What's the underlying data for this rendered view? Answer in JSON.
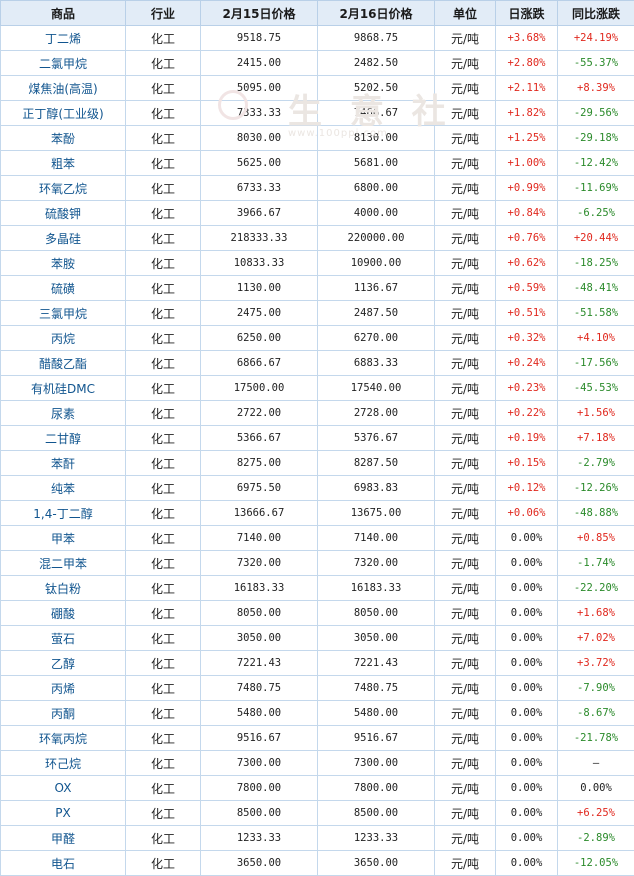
{
  "headers": [
    "商品",
    "行业",
    "2月15日价格",
    "2月16日价格",
    "单位",
    "日涨跌",
    "同比涨跌"
  ],
  "watermark": {
    "text": "生 意 社",
    "url": "www.100ppi.com"
  },
  "colors": {
    "up": "#e0281e",
    "down": "#2a8a2a",
    "header_bg": "#e2ecf7",
    "link": "#11558f"
  },
  "rows": [
    {
      "name": "丁二烯",
      "ind": "化工",
      "p1": "9518.75",
      "p2": "9868.75",
      "unit": "元/吨",
      "day": "+3.68%",
      "yoy": "+24.19%"
    },
    {
      "name": "二氯甲烷",
      "ind": "化工",
      "p1": "2415.00",
      "p2": "2482.50",
      "unit": "元/吨",
      "day": "+2.80%",
      "yoy": "-55.37%"
    },
    {
      "name": "煤焦油(高温)",
      "ind": "化工",
      "p1": "5095.00",
      "p2": "5202.50",
      "unit": "元/吨",
      "day": "+2.11%",
      "yoy": "+8.39%"
    },
    {
      "name": "正丁醇(工业级)",
      "ind": "化工",
      "p1": "7333.33",
      "p2": "7466.67",
      "unit": "元/吨",
      "day": "+1.82%",
      "yoy": "-29.56%"
    },
    {
      "name": "苯酚",
      "ind": "化工",
      "p1": "8030.00",
      "p2": "8130.00",
      "unit": "元/吨",
      "day": "+1.25%",
      "yoy": "-29.18%"
    },
    {
      "name": "粗苯",
      "ind": "化工",
      "p1": "5625.00",
      "p2": "5681.00",
      "unit": "元/吨",
      "day": "+1.00%",
      "yoy": "-12.42%"
    },
    {
      "name": "环氧乙烷",
      "ind": "化工",
      "p1": "6733.33",
      "p2": "6800.00",
      "unit": "元/吨",
      "day": "+0.99%",
      "yoy": "-11.69%"
    },
    {
      "name": "硫酸钾",
      "ind": "化工",
      "p1": "3966.67",
      "p2": "4000.00",
      "unit": "元/吨",
      "day": "+0.84%",
      "yoy": "-6.25%"
    },
    {
      "name": "多晶硅",
      "ind": "化工",
      "p1": "218333.33",
      "p2": "220000.00",
      "unit": "元/吨",
      "day": "+0.76%",
      "yoy": "+20.44%"
    },
    {
      "name": "苯胺",
      "ind": "化工",
      "p1": "10833.33",
      "p2": "10900.00",
      "unit": "元/吨",
      "day": "+0.62%",
      "yoy": "-18.25%"
    },
    {
      "name": "硫磺",
      "ind": "化工",
      "p1": "1130.00",
      "p2": "1136.67",
      "unit": "元/吨",
      "day": "+0.59%",
      "yoy": "-48.41%"
    },
    {
      "name": "三氯甲烷",
      "ind": "化工",
      "p1": "2475.00",
      "p2": "2487.50",
      "unit": "元/吨",
      "day": "+0.51%",
      "yoy": "-51.58%"
    },
    {
      "name": "丙烷",
      "ind": "化工",
      "p1": "6250.00",
      "p2": "6270.00",
      "unit": "元/吨",
      "day": "+0.32%",
      "yoy": "+4.10%"
    },
    {
      "name": "醋酸乙酯",
      "ind": "化工",
      "p1": "6866.67",
      "p2": "6883.33",
      "unit": "元/吨",
      "day": "+0.24%",
      "yoy": "-17.56%"
    },
    {
      "name": "有机硅DMC",
      "ind": "化工",
      "p1": "17500.00",
      "p2": "17540.00",
      "unit": "元/吨",
      "day": "+0.23%",
      "yoy": "-45.53%"
    },
    {
      "name": "尿素",
      "ind": "化工",
      "p1": "2722.00",
      "p2": "2728.00",
      "unit": "元/吨",
      "day": "+0.22%",
      "yoy": "+1.56%"
    },
    {
      "name": "二甘醇",
      "ind": "化工",
      "p1": "5366.67",
      "p2": "5376.67",
      "unit": "元/吨",
      "day": "+0.19%",
      "yoy": "+7.18%"
    },
    {
      "name": "苯酐",
      "ind": "化工",
      "p1": "8275.00",
      "p2": "8287.50",
      "unit": "元/吨",
      "day": "+0.15%",
      "yoy": "-2.79%"
    },
    {
      "name": "纯苯",
      "ind": "化工",
      "p1": "6975.50",
      "p2": "6983.83",
      "unit": "元/吨",
      "day": "+0.12%",
      "yoy": "-12.26%"
    },
    {
      "name": "1,4-丁二醇",
      "ind": "化工",
      "p1": "13666.67",
      "p2": "13675.00",
      "unit": "元/吨",
      "day": "+0.06%",
      "yoy": "-48.88%"
    },
    {
      "name": "甲苯",
      "ind": "化工",
      "p1": "7140.00",
      "p2": "7140.00",
      "unit": "元/吨",
      "day": "0.00%",
      "yoy": "+0.85%"
    },
    {
      "name": "混二甲苯",
      "ind": "化工",
      "p1": "7320.00",
      "p2": "7320.00",
      "unit": "元/吨",
      "day": "0.00%",
      "yoy": "-1.74%"
    },
    {
      "name": "钛白粉",
      "ind": "化工",
      "p1": "16183.33",
      "p2": "16183.33",
      "unit": "元/吨",
      "day": "0.00%",
      "yoy": "-22.20%"
    },
    {
      "name": "硼酸",
      "ind": "化工",
      "p1": "8050.00",
      "p2": "8050.00",
      "unit": "元/吨",
      "day": "0.00%",
      "yoy": "+1.68%"
    },
    {
      "name": "萤石",
      "ind": "化工",
      "p1": "3050.00",
      "p2": "3050.00",
      "unit": "元/吨",
      "day": "0.00%",
      "yoy": "+7.02%"
    },
    {
      "name": "乙醇",
      "ind": "化工",
      "p1": "7221.43",
      "p2": "7221.43",
      "unit": "元/吨",
      "day": "0.00%",
      "yoy": "+3.72%"
    },
    {
      "name": "丙烯",
      "ind": "化工",
      "p1": "7480.75",
      "p2": "7480.75",
      "unit": "元/吨",
      "day": "0.00%",
      "yoy": "-7.90%"
    },
    {
      "name": "丙酮",
      "ind": "化工",
      "p1": "5480.00",
      "p2": "5480.00",
      "unit": "元/吨",
      "day": "0.00%",
      "yoy": "-8.67%"
    },
    {
      "name": "环氧丙烷",
      "ind": "化工",
      "p1": "9516.67",
      "p2": "9516.67",
      "unit": "元/吨",
      "day": "0.00%",
      "yoy": "-21.78%"
    },
    {
      "name": "环己烷",
      "ind": "化工",
      "p1": "7300.00",
      "p2": "7300.00",
      "unit": "元/吨",
      "day": "0.00%",
      "yoy": "—"
    },
    {
      "name": "OX",
      "ind": "化工",
      "p1": "7800.00",
      "p2": "7800.00",
      "unit": "元/吨",
      "day": "0.00%",
      "yoy": "0.00%"
    },
    {
      "name": "PX",
      "ind": "化工",
      "p1": "8500.00",
      "p2": "8500.00",
      "unit": "元/吨",
      "day": "0.00%",
      "yoy": "+6.25%"
    },
    {
      "name": "甲醛",
      "ind": "化工",
      "p1": "1233.33",
      "p2": "1233.33",
      "unit": "元/吨",
      "day": "0.00%",
      "yoy": "-2.89%"
    },
    {
      "name": "电石",
      "ind": "化工",
      "p1": "3650.00",
      "p2": "3650.00",
      "unit": "元/吨",
      "day": "0.00%",
      "yoy": "-12.05%"
    }
  ]
}
